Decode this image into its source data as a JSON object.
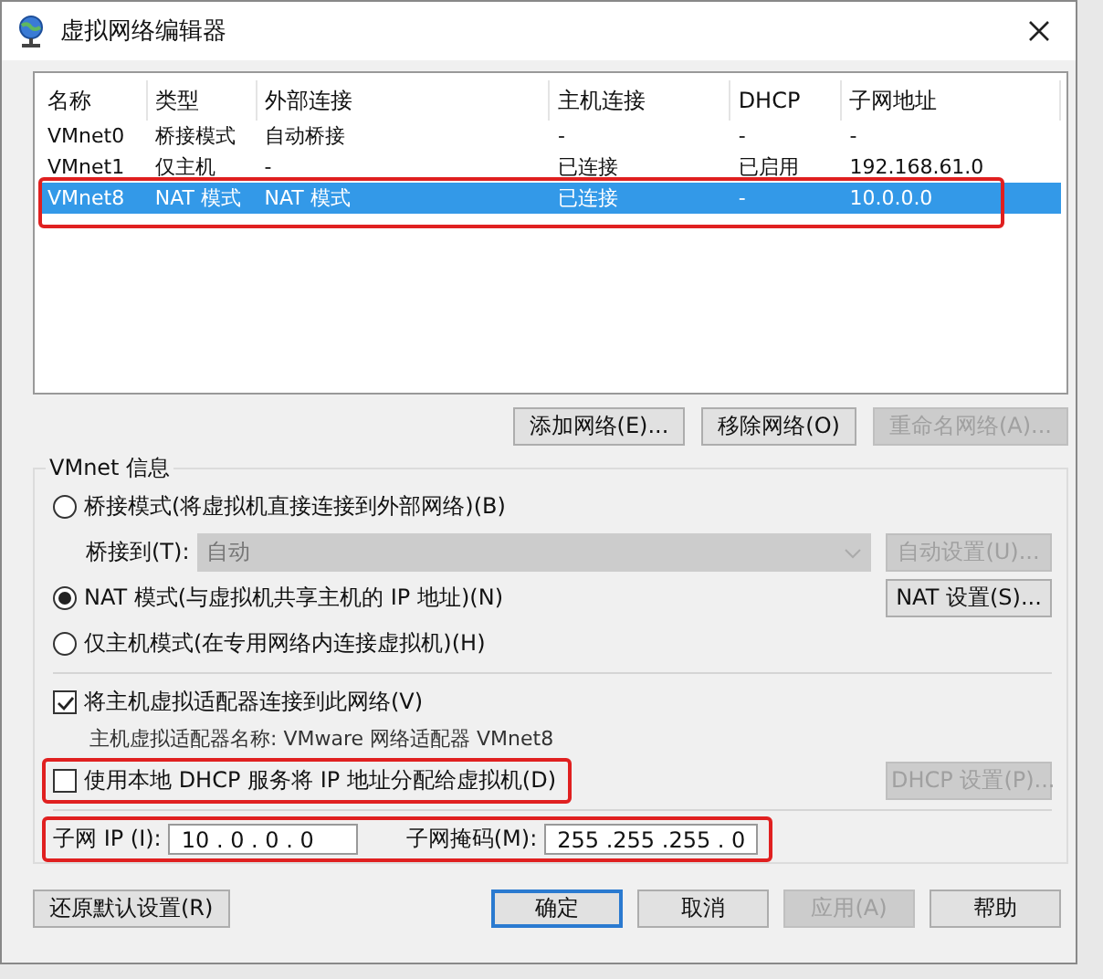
{
  "window": {
    "title": "虚拟网络编辑器"
  },
  "table": {
    "columns": [
      "名称",
      "类型",
      "外部连接",
      "主机连接",
      "DHCP",
      "子网地址"
    ],
    "rows": [
      {
        "cells": [
          "VMnet0",
          "桥接模式",
          "自动桥接",
          "-",
          "-",
          "-"
        ],
        "selected": false,
        "highlighted": false
      },
      {
        "cells": [
          "VMnet1",
          "仅主机",
          "-",
          "已连接",
          "已启用",
          "192.168.61.0"
        ],
        "selected": false,
        "highlighted": false
      },
      {
        "cells": [
          "VMnet8",
          "NAT 模式",
          "NAT 模式",
          "已连接",
          "-",
          "10.0.0.0"
        ],
        "selected": true,
        "highlighted": true
      }
    ]
  },
  "table_buttons": [
    {
      "label": "添加网络(E)...",
      "disabled": false
    },
    {
      "label": "移除网络(O)",
      "disabled": false
    },
    {
      "label": "重命名网络(A)...",
      "disabled": true
    }
  ],
  "vmnet_info": {
    "title": "VMnet 信息",
    "modes": [
      {
        "label": "桥接模式(将虚拟机直接连接到外部网络)(B)",
        "selected": false
      },
      {
        "label": "NAT 模式(与虚拟机共享主机的 IP 地址)(N)",
        "selected": true
      },
      {
        "label": "仅主机模式(在专用网络内连接虚拟机)(H)",
        "selected": false
      }
    ],
    "bridge_to": {
      "label": "桥接到(T):",
      "value": "自动",
      "disabled": true
    },
    "auto_settings": {
      "label": "自动设置(U)...",
      "disabled": true
    },
    "nat_settings": {
      "label": "NAT 设置(S)...",
      "disabled": false
    },
    "connect_adapter": {
      "label": "将主机虚拟适配器连接到此网络(V)",
      "checked": true
    },
    "adapter_name": "主机虚拟适配器名称: VMware 网络适配器 VMnet8",
    "dhcp": {
      "label": "使用本地 DHCP 服务将 IP 地址分配给虚拟机(D)",
      "checked": false,
      "highlighted": true
    },
    "dhcp_settings": {
      "label": "DHCP 设置(P)...",
      "disabled": true
    },
    "subnet": {
      "highlighted": true,
      "ip_label": "子网 IP (I):",
      "ip_value": "10 . 0 . 0 . 0",
      "mask_label": "子网掩码(M):",
      "mask_value": "255 .255 .255 . 0"
    }
  },
  "footer": {
    "restore": {
      "label": "还原默认设置(R)",
      "disabled": false
    },
    "buttons": [
      {
        "label": "确定",
        "disabled": false,
        "default": true
      },
      {
        "label": "取消",
        "disabled": false,
        "default": false
      },
      {
        "label": "应用(A)",
        "disabled": true,
        "default": false
      },
      {
        "label": "帮助",
        "disabled": false,
        "default": false
      }
    ]
  }
}
